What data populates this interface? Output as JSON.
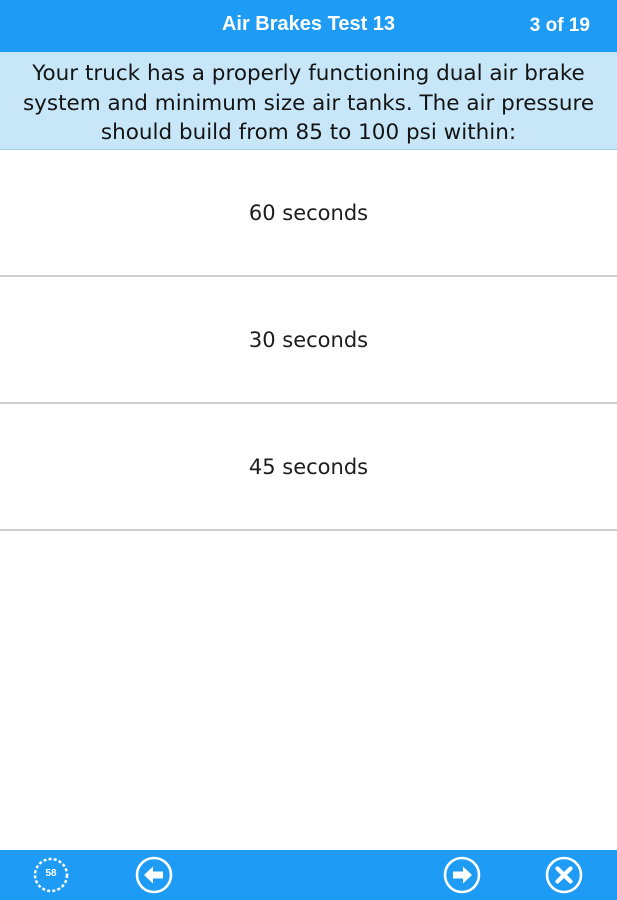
{
  "header": {
    "title": "Air Brakes Test 13",
    "progress": "3 of 19"
  },
  "question": {
    "text": "Your truck has a properly functioning dual air brake system and minimum size air tanks. The air pressure should build from 85 to 100 psi within:"
  },
  "answers": [
    {
      "label": "60 seconds"
    },
    {
      "label": "30 seconds"
    },
    {
      "label": "45 seconds"
    }
  ],
  "toolbar": {
    "timer_value": "58",
    "icons": [
      "timer-icon",
      "back-arrow-icon",
      "forward-arrow-icon",
      "close-icon"
    ]
  },
  "colors": {
    "accent": "#1e9cf5",
    "question_bg": "#c7e6f8",
    "divider": "#cfcfcf"
  }
}
